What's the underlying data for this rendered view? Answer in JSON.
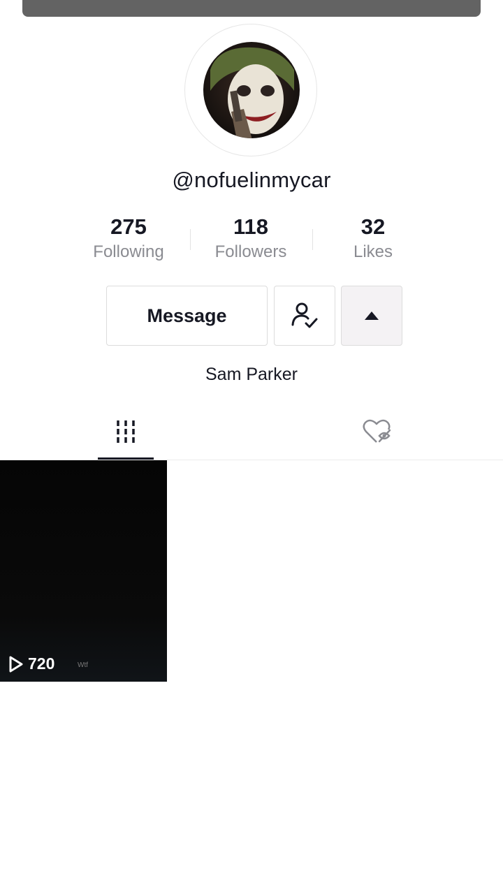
{
  "profile": {
    "username": "@nofuelinmycar",
    "display_name": "Sam Parker",
    "avatar_alt": "profile avatar"
  },
  "stats": [
    {
      "value": "275",
      "label": "Following"
    },
    {
      "value": "118",
      "label": "Followers"
    },
    {
      "value": "32",
      "label": "Likes"
    }
  ],
  "actions": {
    "message_label": "Message",
    "friend_icon": "user-check-icon",
    "toggle_icon": "triangle-up-icon"
  },
  "tabs": [
    {
      "icon": "videos-grid-icon",
      "active": true
    },
    {
      "icon": "liked-hidden-icon",
      "active": false
    }
  ],
  "videos": [
    {
      "views": "720",
      "watermark": "Wtf"
    }
  ],
  "colors": {
    "text": "#161823",
    "muted": "#8a8b91",
    "border": "#dcdcdc"
  }
}
